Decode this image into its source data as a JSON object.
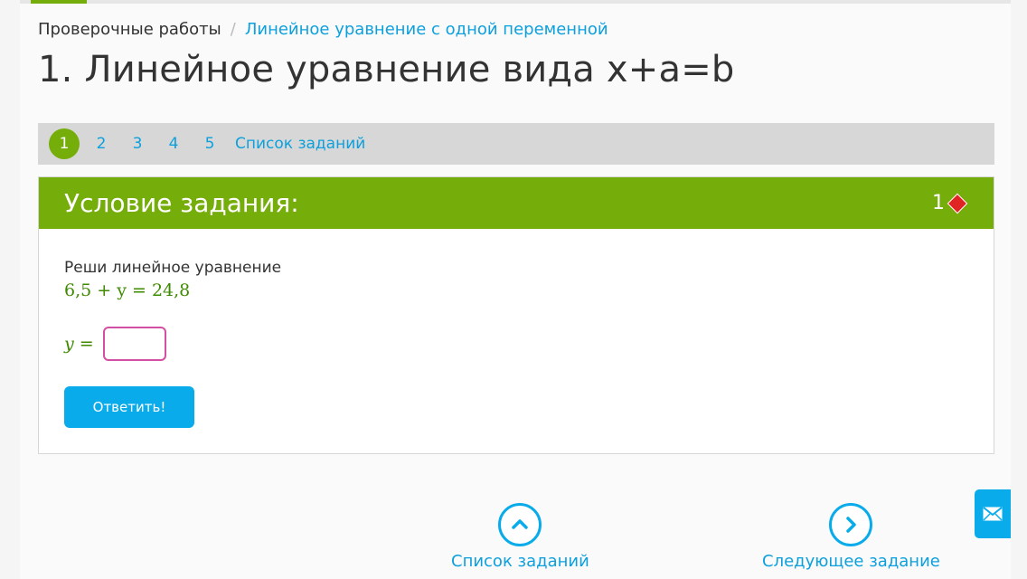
{
  "breadcrumb": {
    "root": "Проверочные работы",
    "separator": "/",
    "current": "Линейное уравнение с одной переменной"
  },
  "page_title": "1. Линейное уравнение вида x+a=b",
  "task_nav": {
    "items": [
      "1",
      "2",
      "3",
      "4",
      "5"
    ],
    "active_index": 0,
    "list_link": "Список заданий"
  },
  "card": {
    "title": "Условие задания:",
    "points": "1",
    "prompt": "Реши линейное уравнение",
    "equation": "6,5 + y = 24,8",
    "answer_label": "y =",
    "answer_value": "",
    "submit_label": "Ответить!"
  },
  "bottom_nav": {
    "list_label": "Список заданий",
    "next_label": "Следующее задание"
  },
  "colors": {
    "accent_green": "#75ad0a",
    "link_blue": "#0da0dd",
    "button_blue": "#0aabea",
    "math_green": "#3e8a00",
    "input_border": "#d24fa4",
    "diamond_red": "#e02424"
  },
  "icons": {
    "points": "diamond-icon",
    "list": "chevron-up-icon",
    "next": "chevron-right-icon",
    "feedback": "mail-icon"
  }
}
